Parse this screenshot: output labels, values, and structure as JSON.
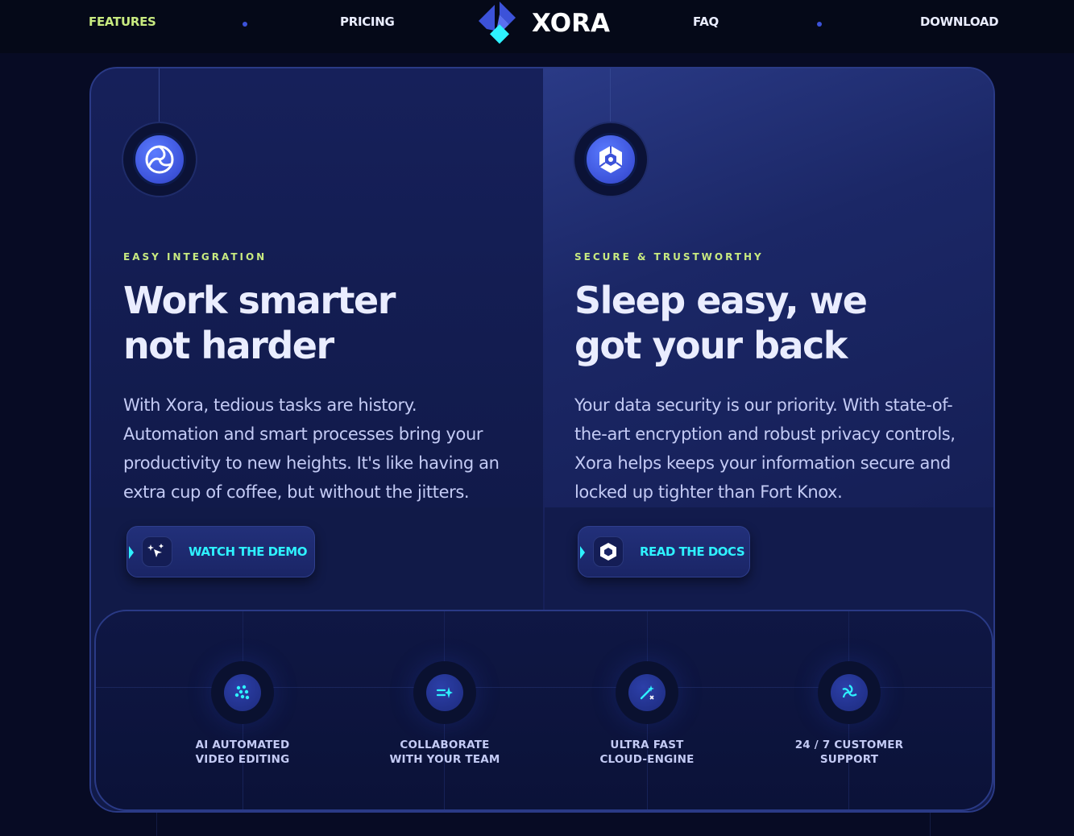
{
  "nav": {
    "links": [
      {
        "label": "FEATURES",
        "active": true
      },
      {
        "label": "PRICING",
        "active": false
      },
      {
        "label": "FAQ",
        "active": false
      },
      {
        "label": "DOWNLOAD",
        "active": false
      }
    ],
    "logo_text": "XORA"
  },
  "columns": [
    {
      "icon": "swirl-icon",
      "eyebrow": "EASY INTEGRATION",
      "headline": "Work smarter\nnot harder",
      "body": "With Xora, tedious tasks are history. Automation and smart processes bring your productivity to new heights. It's like having an extra cup of coffee, but without the jitters.",
      "cta_label": "WATCH THE DEMO",
      "cta_icon": "magic-cursor-icon"
    },
    {
      "icon": "shield-hex-icon",
      "eyebrow": "SECURE & TRUSTWORTHY",
      "headline": "Sleep easy, we\ngot your back",
      "body": "Your data security is our priority. With state-of-the-art encryption and robust privacy controls, Xora helps keeps your information secure and locked up tighter than Fort Knox.",
      "cta_label": "READ THE DOCS",
      "cta_icon": "docs-hex-icon"
    }
  ],
  "features": [
    {
      "label": "AI AUTOMATED\nVIDEO EDITING",
      "icon": "ai-dots-icon"
    },
    {
      "label": "COLLABORATE\nWITH YOUR TEAM",
      "icon": "collab-arrows-icon"
    },
    {
      "label": "ULTRA FAST\nCLOUD-ENGINE",
      "icon": "wand-icon"
    },
    {
      "label": "24 / 7 CUSTOMER\nSUPPORT",
      "icon": "support-swirl-icon"
    }
  ],
  "colors": {
    "accent_lime": "#c8ea80",
    "accent_cyan": "#2ef2ff",
    "brand_blue": "#3c52d9",
    "background": "#070b24"
  }
}
